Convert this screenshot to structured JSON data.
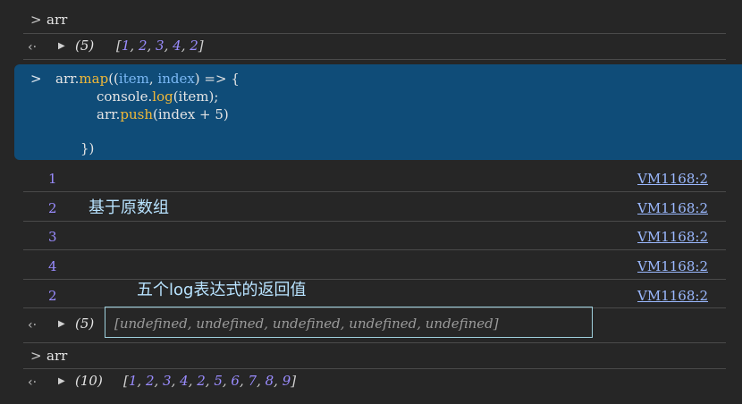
{
  "rows": {
    "input1": "arr",
    "result1": {
      "count": "(5)",
      "open": "[",
      "items": [
        "1",
        "2",
        "3",
        "4",
        "2"
      ],
      "close": "]"
    },
    "code_lines": {
      "l1_a": "arr.",
      "l1_kw": "map",
      "l1_b": "((",
      "l1_p1": "item",
      "l1_c": ", ",
      "l1_p2": "index",
      "l1_d": ") => {",
      "l2_a": "console.",
      "l2_kw": "log",
      "l2_b": "(item);",
      "l3_a": "arr.",
      "l3_kw": "push",
      "l3_b": "(index + 5)",
      "l5": "})"
    },
    "logs": [
      "1",
      "2",
      "3",
      "4",
      "2"
    ],
    "log_source": "VM1168:2",
    "annot1": "基于原数组",
    "annot2": "五个log表达式的返回值",
    "result2": {
      "count": "(5)",
      "text": "[undefined, undefined, undefined, undefined, undefined]"
    },
    "input2": "arr",
    "result3": {
      "count": "(10)",
      "open": "[",
      "items": [
        "1",
        "2",
        "3",
        "4",
        "2",
        "5",
        "6",
        "7",
        "8",
        "9"
      ],
      "close": "]"
    }
  },
  "glyphs": {
    "prompt": ">",
    "return": "‹·",
    "expand": "▶"
  }
}
